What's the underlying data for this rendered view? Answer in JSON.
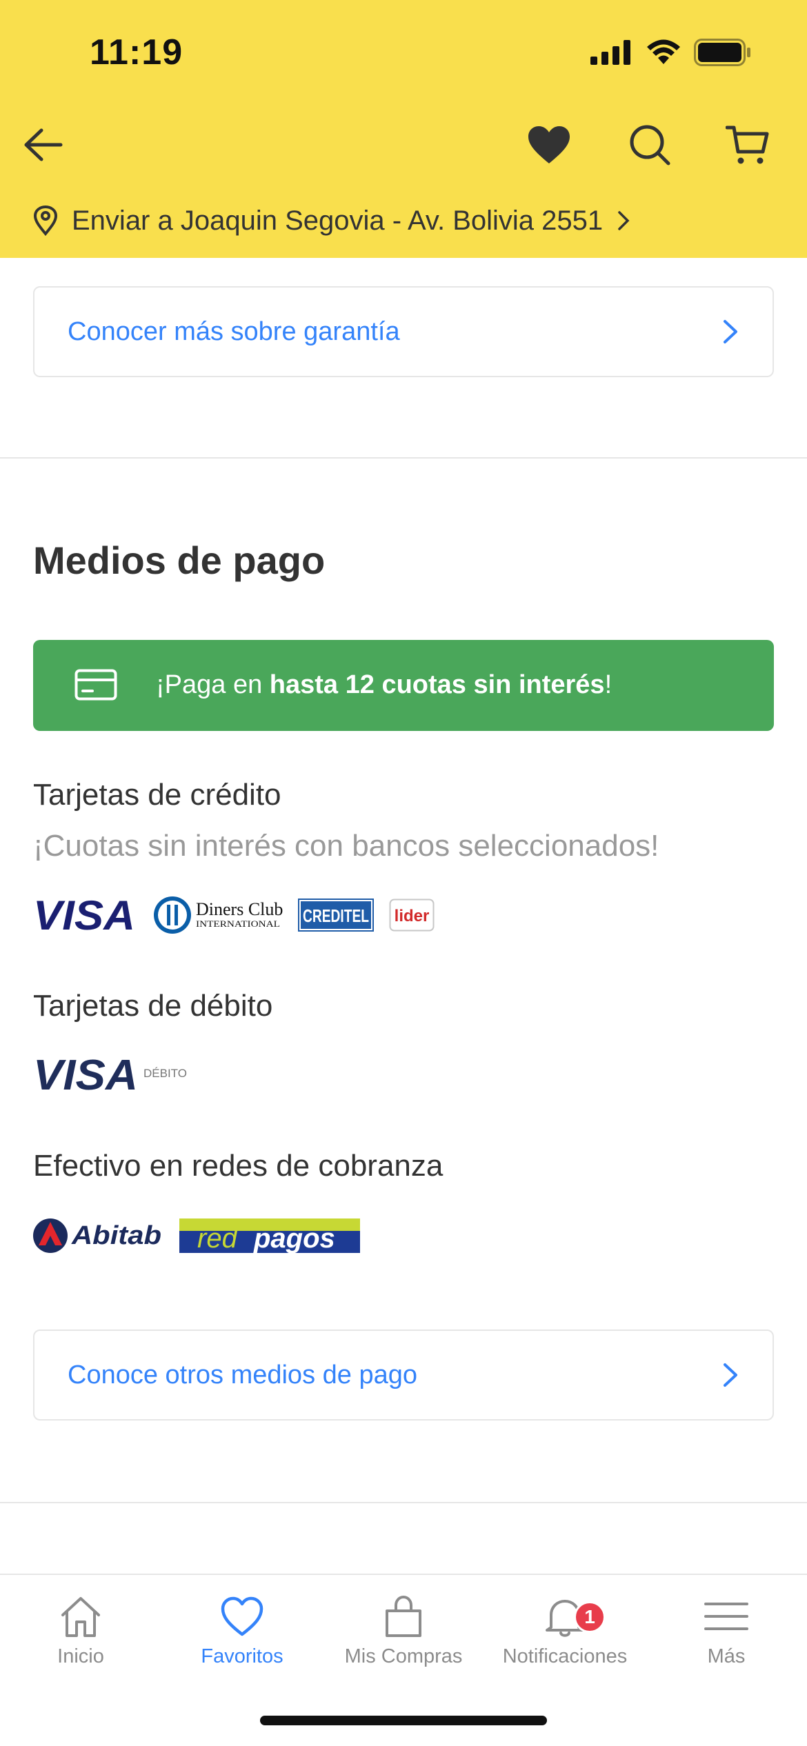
{
  "status_bar": {
    "time": "11:19"
  },
  "header": {
    "back_icon": "arrow-left-icon",
    "favorite_icon": "heart-filled-icon",
    "search_icon": "search-icon",
    "cart_icon": "cart-icon",
    "address_icon": "location-pin-icon",
    "address": "Enviar a Joaquin Segovia - Av. Bolivia 2551"
  },
  "guarantee_link": {
    "label": "Conocer más sobre garantía"
  },
  "payment": {
    "title": "Medios de pago",
    "promo": {
      "prefix": "¡Paga en ",
      "bold": "hasta 12 cuotas sin interés",
      "suffix": "!"
    },
    "credit": {
      "title": "Tarjetas de crédito",
      "subtitle": "¡Cuotas sin interés con bancos seleccionados!",
      "logos": {
        "visa": "VISA",
        "diners_line1": "Diners Club",
        "diners_line2": "INTERNATIONAL",
        "creditel": "CREDITEL",
        "lider": "lider"
      }
    },
    "debit": {
      "title": "Tarjetas de débito",
      "logos": {
        "visa": "VISA",
        "debito": "DÉBITO"
      }
    },
    "cash": {
      "title": "Efectivo en redes de cobranza",
      "logos": {
        "abitab": "Abitab",
        "redpagos_red": "red",
        "redpagos_pagos": "pagos"
      }
    },
    "other_link": {
      "label": "Conoce otros medios de pago"
    }
  },
  "tabbar": {
    "tabs": [
      {
        "label": "Inicio",
        "icon": "home-icon"
      },
      {
        "label": "Favoritos",
        "icon": "heart-icon"
      },
      {
        "label": "Mis Compras",
        "icon": "shopping-bag-icon"
      },
      {
        "label": "Notificaciones",
        "icon": "bell-icon",
        "badge": "1"
      },
      {
        "label": "Más",
        "icon": "menu-icon"
      }
    ]
  },
  "colors": {
    "header_bg": "#f9df4d",
    "link_blue": "#3483fa",
    "promo_green": "#4aa75a",
    "badge_red": "#e83d4b"
  }
}
